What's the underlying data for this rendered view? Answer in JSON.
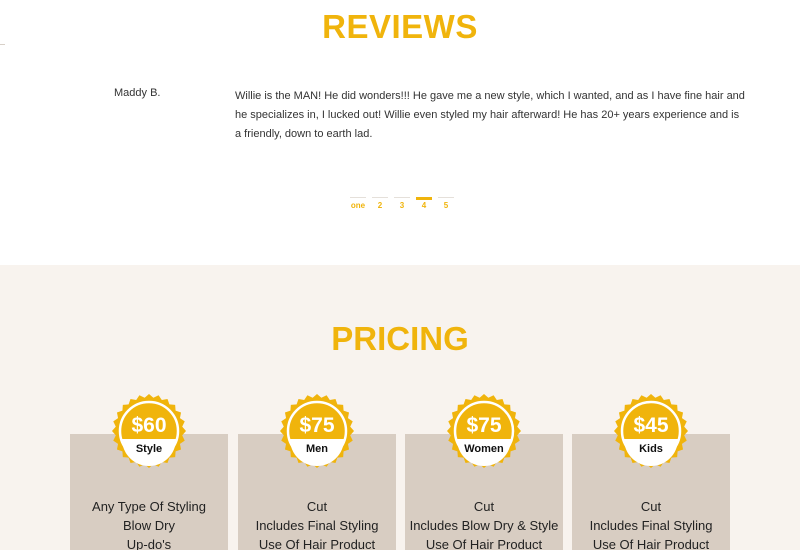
{
  "reviews": {
    "title": "REVIEWS",
    "reviewer": "Maddy B.",
    "text": "Willie is the MAN! He did wonders!!! He gave me a new style, which I wanted, and as I have fine hair and he specializes in, I lucked out! Willie even styled my hair afterward! He has 20+ years experience and is a friendly, down to earth lad.",
    "pages": [
      "one",
      "2",
      "3",
      "4",
      "5"
    ],
    "active_page": "4"
  },
  "pricing": {
    "title": "PRICING",
    "plans": [
      {
        "price": "$60",
        "name": "Style",
        "items": [
          "Any Type Of Styling",
          "Blow Dry",
          "Up-do's"
        ]
      },
      {
        "price": "$75",
        "name": "Men",
        "items": [
          "Cut",
          "Includes Final Styling",
          "Use Of Hair Product"
        ]
      },
      {
        "price": "$75",
        "name": "Women",
        "items": [
          "Cut",
          "Includes Blow Dry & Style",
          "Use Of Hair Product"
        ]
      },
      {
        "price": "$45",
        "name": "Kids",
        "items": [
          "Cut",
          "Includes Final Styling",
          "Use Of Hair Product"
        ]
      }
    ]
  },
  "colors": {
    "accent": "#f0b40c",
    "card": "#d8cdc2",
    "pricing_bg": "#f8f3ee"
  }
}
